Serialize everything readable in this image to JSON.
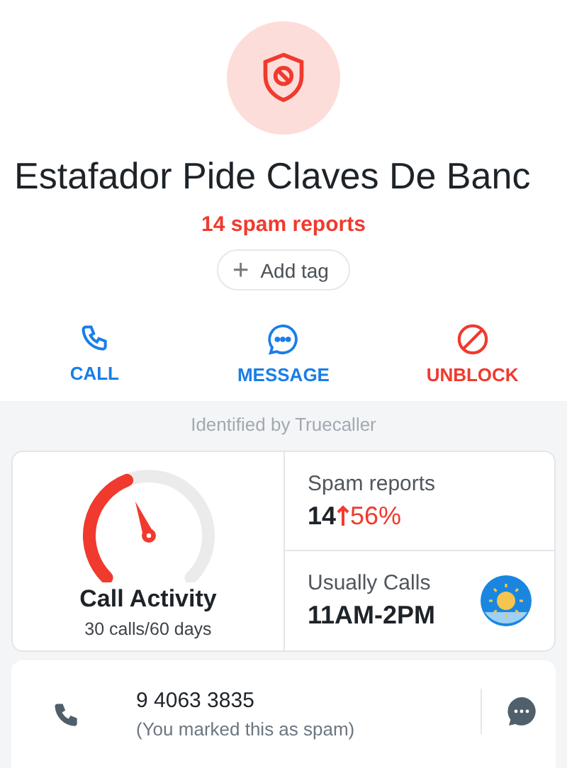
{
  "profile": {
    "name": "Estafador Pide Claves De Banc",
    "spam_label": "14 spam reports",
    "add_tag": {
      "icon": "+",
      "label": "Add tag"
    }
  },
  "actions": [
    {
      "kind": "call",
      "label": "CALL"
    },
    {
      "kind": "message",
      "label": "MESSAGE"
    },
    {
      "kind": "unblock",
      "label": "UNBLOCK"
    }
  ],
  "source": "Identified by Truecaller",
  "stats": {
    "activity": {
      "title": "Call Activity",
      "subtitle": "30 calls/60 days"
    },
    "spam": {
      "label": "Spam reports",
      "count": "14",
      "change": "56%"
    },
    "usual": {
      "label": "Usually Calls",
      "value": "11AM-2PM"
    }
  },
  "number": {
    "value": "9 4063 3835",
    "note": "(You marked this as spam)"
  }
}
